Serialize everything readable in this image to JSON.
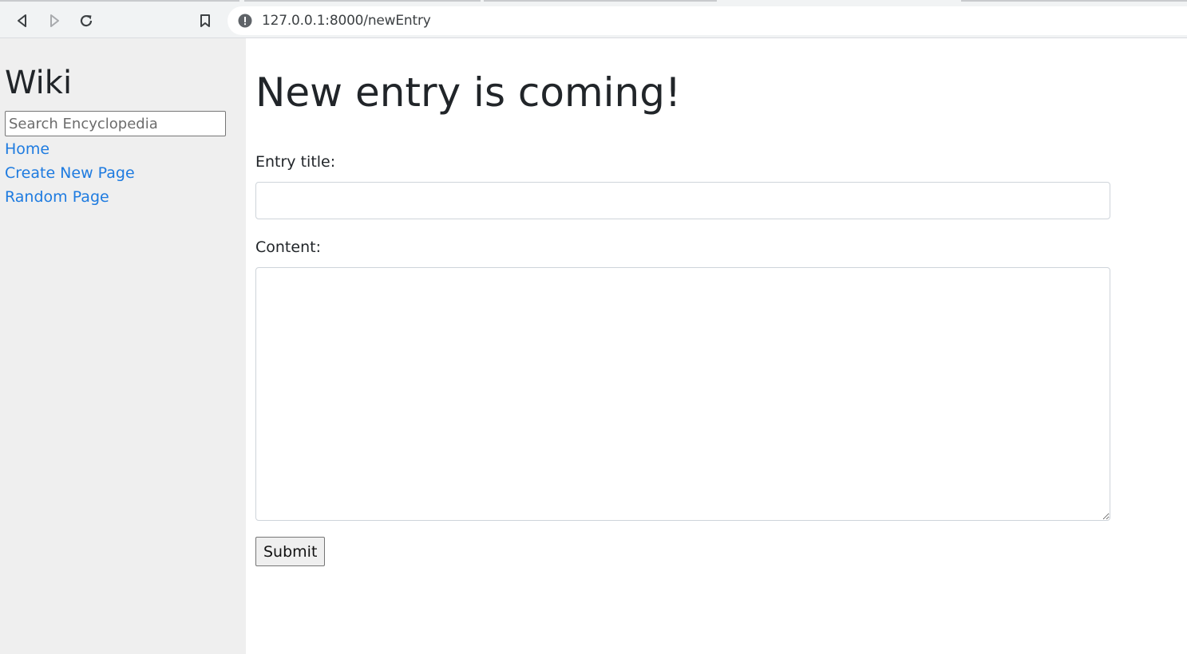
{
  "browser": {
    "url": "127.0.0.1:8000/newEntry",
    "back_icon": "back-arrow-icon",
    "forward_icon": "forward-arrow-icon",
    "reload_icon": "reload-icon",
    "bookmark_icon": "bookmark-icon",
    "site_info_icon": "not-secure-info-icon"
  },
  "sidebar": {
    "brand": "Wiki",
    "search": {
      "placeholder": "Search Encyclopedia",
      "value": ""
    },
    "links": [
      {
        "label": "Home"
      },
      {
        "label": "Create New Page"
      },
      {
        "label": "Random Page"
      }
    ]
  },
  "main": {
    "title": "New entry is coming!",
    "form": {
      "title_label": "Entry title:",
      "title_value": "",
      "content_label": "Content:",
      "content_value": "",
      "submit_label": "Submit"
    }
  },
  "colors": {
    "link": "#1e7be0",
    "sidebar_bg": "#efefef",
    "text": "#212529"
  }
}
